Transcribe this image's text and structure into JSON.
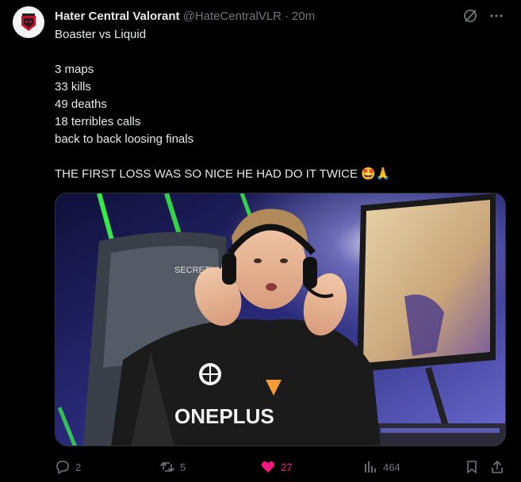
{
  "author": {
    "name": "Hater Central Valorant",
    "handle": "@HateCentralVLR",
    "time": "20m",
    "separator": "·"
  },
  "tweet": {
    "lines": [
      "Boaster vs Liquid",
      "",
      "3 maps",
      "33 kills",
      "49 deaths",
      "18 terribles calls",
      "back to back loosing finals",
      "",
      "THE FIRST LOSS WAS SO NICE HE HAD DO IT TWICE 🤩🙏"
    ]
  },
  "media": {
    "jersey_text": "ONEPLUS",
    "chair_text": "SECRETLAB"
  },
  "actions": {
    "replies": "2",
    "retweets": "5",
    "likes": "27",
    "views": "464"
  },
  "colors": {
    "accent_like": "#f91880",
    "muted": "#71767b",
    "text": "#e7e9ea"
  },
  "icons": {
    "more": "more-icon",
    "grok": "grok-icon",
    "reply": "reply-icon",
    "retweet": "retweet-icon",
    "like": "heart-icon",
    "views": "views-icon",
    "bookmark": "bookmark-icon",
    "share": "share-icon"
  }
}
